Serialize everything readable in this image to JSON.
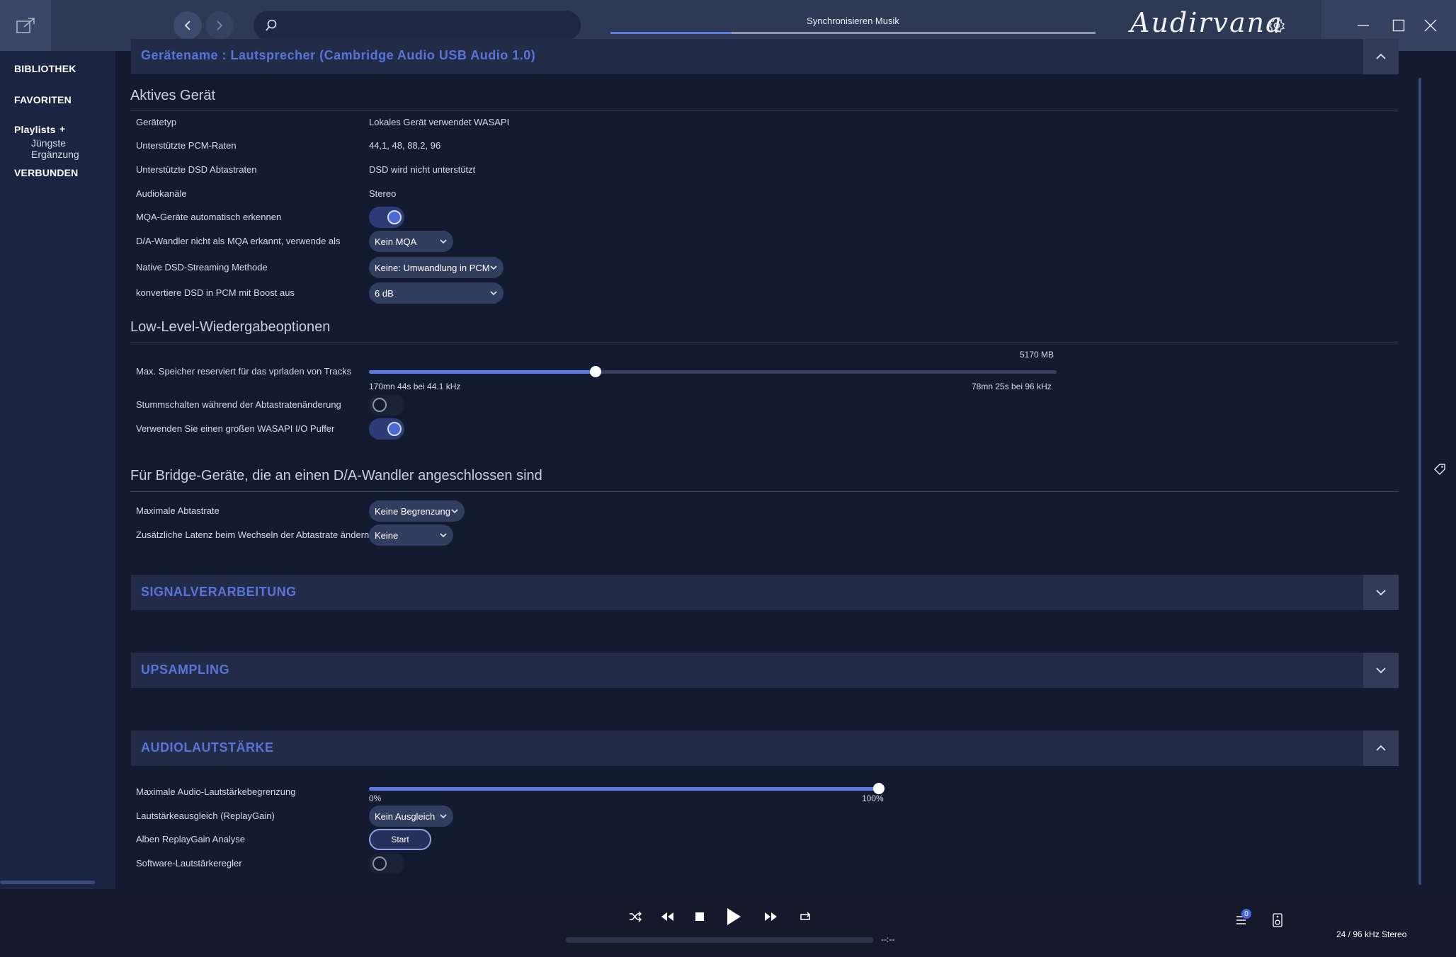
{
  "topbar": {
    "search_placeholder": "",
    "sync_label": "Synchronisieren Musik",
    "sync_progress": 0.25,
    "brand": "Audirvana"
  },
  "sidebar": {
    "library": "BIBLIOTHEK",
    "favorites": "FAVORITEN",
    "playlists": "Playlists",
    "playlists_add": "+",
    "recent": "Jüngste Ergänzung",
    "connected": "VERBUNDEN"
  },
  "device_section": {
    "title": "Gerätename : Lautsprecher (Cambridge Audio USB Audio 1.0)"
  },
  "active_device": {
    "heading": "Aktives Gerät",
    "rows": [
      {
        "label": "Gerätetyp",
        "value": "Lokales Gerät verwendet WASAPI"
      },
      {
        "label": "Unterstützte PCM-Raten",
        "value": "44,1, 48, 88,2, 96"
      },
      {
        "label": "Unterstützte DSD Abtastraten",
        "value": "DSD wird nicht unterstützt"
      },
      {
        "label": "Audiokanäle",
        "value": "Stereo"
      }
    ],
    "mqa_auto_label": "MQA-Geräte automatisch erkennen",
    "mqa_auto_on": true,
    "dac_mqa_label": "D/A-Wandler nicht als MQA erkannt, verwende als",
    "dac_mqa_value": "Kein MQA",
    "dsd_method_label": "Native DSD-Streaming Methode",
    "dsd_method_value": "Keine: Umwandlung in PCM",
    "dsd_boost_label": "konvertiere DSD in PCM mit Boost aus",
    "dsd_boost_value": "6 dB"
  },
  "low_level": {
    "heading": "Low-Level-Wiedergabeoptionen",
    "memory_label": "Max. Speicher reserviert für das vprladen von Tracks",
    "memory_value": "5170 MB",
    "memory_fraction": 0.33,
    "memory_min_text": "170mn 44s bei 44.1 kHz",
    "memory_max_text": "78mn 25s bei 96 kHz",
    "mute_label": "Stummschalten während der Abtastratenänderung",
    "mute_on": false,
    "wasapi_label": "Verwenden Sie einen großen WASAPI I/O Puffer",
    "wasapi_on": true
  },
  "bridge": {
    "heading": "Für Bridge-Geräte, die an einen D/A-Wandler angeschlossen sind",
    "max_rate_label": "Maximale Abtastrate",
    "max_rate_value": "Keine Begrenzung",
    "latency_label": "Zusätzliche Latenz beim Wechseln der Abtastrate ändern",
    "latency_value": "Keine"
  },
  "sections": {
    "signal": "SIGNALVERARBEITUNG",
    "upsampling": "UPSAMPLING",
    "volume": "AUDIOLAUTSTÄRKE"
  },
  "volume": {
    "max_label": "Maximale Audio-Lautstärkebegrenzung",
    "max_fraction": 1.0,
    "min_text": "0%",
    "max_text": "100%",
    "replaygain_label": "Lautstärkeausgleich (ReplayGain)",
    "replaygain_value": "Kein Ausgleich",
    "analysis_label": "Alben ReplayGain Analyse",
    "analysis_button": "Start",
    "software_label": "Software-Lautstärkeregler",
    "software_on": false
  },
  "player": {
    "time": "--:--",
    "queue_count": "0",
    "format": "24 / 96 kHz Stereo"
  }
}
